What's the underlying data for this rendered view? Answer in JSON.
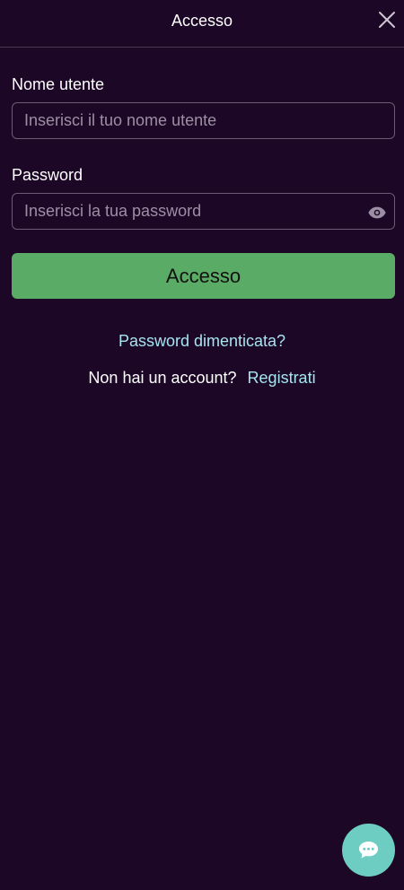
{
  "header": {
    "title": "Accesso",
    "close_icon": "close-icon"
  },
  "form": {
    "username": {
      "label": "Nome utente",
      "placeholder": "Inserisci il tuo nome utente",
      "value": ""
    },
    "password": {
      "label": "Password",
      "placeholder": "Inserisci la tua password",
      "value": "",
      "toggle_icon": "eye-icon"
    },
    "submit_label": "Accesso"
  },
  "links": {
    "forgot_password": "Password dimenticata?",
    "no_account_text": "Non hai un account?",
    "register": "Registrati"
  },
  "chat": {
    "icon": "chat-icon"
  },
  "colors": {
    "background": "#1d0726",
    "primary_button": "#5aab66",
    "link": "#a6e4f0",
    "chat_button": "#6ecdc3"
  }
}
